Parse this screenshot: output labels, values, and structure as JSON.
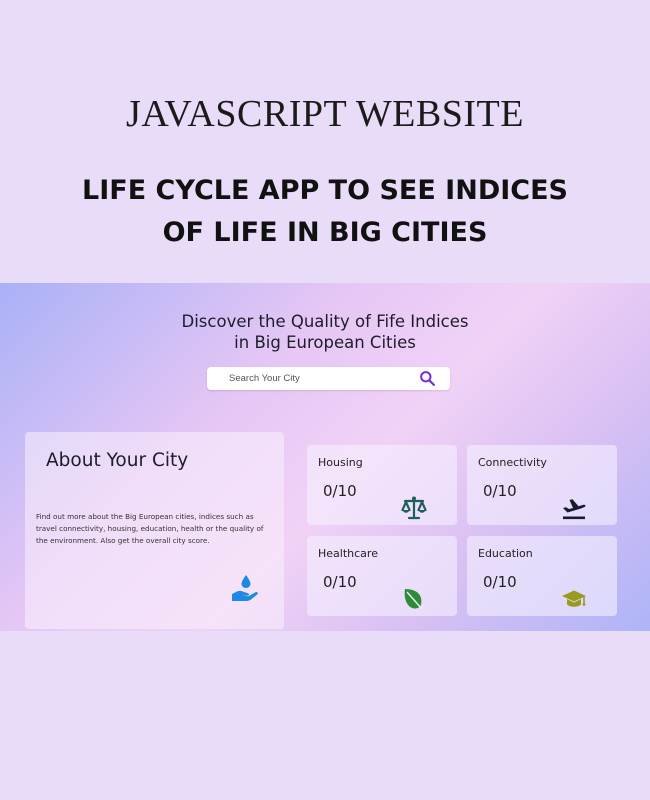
{
  "banner": {
    "title": "JAVASCRIPT WEBSITE",
    "subtitle_line1": "LIFE CYCLE APP TO SEE INDICES",
    "subtitle_line2": "OF LIFE IN BIG CITIES"
  },
  "app": {
    "hero_line1": "Discover the Quality of Fife Indices",
    "hero_line2": "in Big European Cities",
    "search": {
      "placeholder": "Search Your City",
      "value": "",
      "icon": "search-icon",
      "icon_color": "#7b2fd0"
    },
    "about": {
      "title": "About Your City",
      "description": "Find out more about the Big European cities, indices such as travel connectivity, housing, education, health or the quality of the environment. Also get the overall city score.",
      "icon": "water-hand-icon",
      "icon_color": "#1e88e5"
    },
    "indices": [
      {
        "label": "Housing",
        "score": "0/10",
        "icon": "scale-icon",
        "color": "#1f5f5b"
      },
      {
        "label": "Connectivity",
        "score": "0/10",
        "icon": "airplane-icon",
        "color": "#1a1a2e"
      },
      {
        "label": "Healthcare",
        "score": "0/10",
        "icon": "leaf-icon",
        "color": "#2e8b3a"
      },
      {
        "label": "Education",
        "score": "0/10",
        "icon": "graduation-cap-icon",
        "color": "#9a9a1e"
      }
    ]
  }
}
